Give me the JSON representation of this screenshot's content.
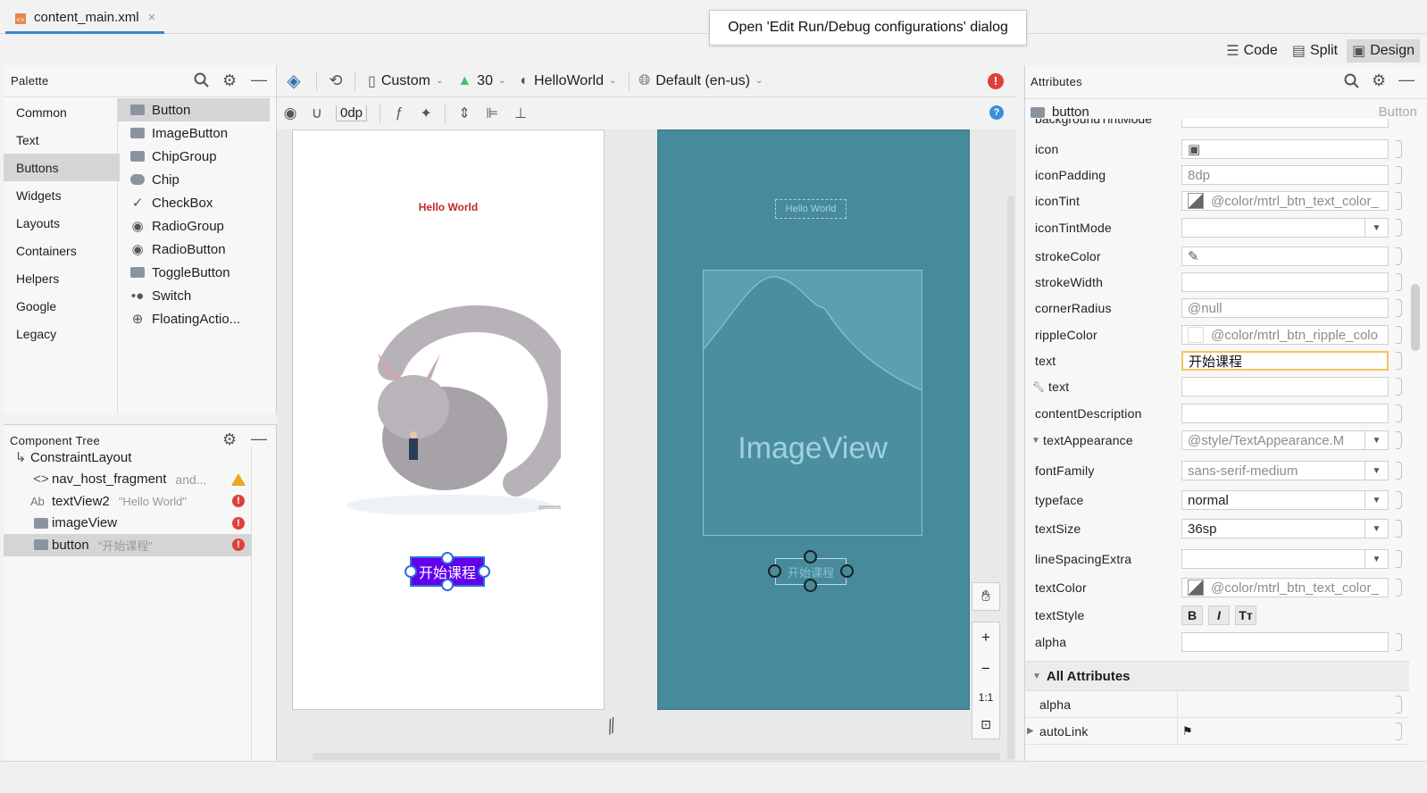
{
  "file_tab": {
    "name": "content_main.xml",
    "close": "×"
  },
  "tooltip": "Open 'Edit Run/Debug configurations' dialog",
  "view_modes": {
    "code": "Code",
    "split": "Split",
    "design": "Design"
  },
  "palette": {
    "title": "Palette",
    "categories": [
      "Common",
      "Text",
      "Buttons",
      "Widgets",
      "Layouts",
      "Containers",
      "Helpers",
      "Google",
      "Legacy"
    ],
    "selected_category": "Buttons",
    "items": [
      "Button",
      "ImageButton",
      "ChipGroup",
      "Chip",
      "CheckBox",
      "RadioGroup",
      "RadioButton",
      "ToggleButton",
      "Switch",
      "FloatingActio..."
    ]
  },
  "component_tree": {
    "title": "Component Tree",
    "rows": [
      {
        "label": "ConstraintLayout",
        "hint": "",
        "status": ""
      },
      {
        "label": "nav_host_fragment",
        "hint": "and...",
        "status": "warning"
      },
      {
        "label": "textView2",
        "hint": "\"Hello World\"",
        "status": "error"
      },
      {
        "label": "imageView",
        "hint": "",
        "status": "error"
      },
      {
        "label": "button",
        "hint": "\"开始课程\"",
        "status": "error"
      }
    ],
    "ab_prefix": "Ab"
  },
  "design_toolbar": {
    "device": "Custom",
    "api": "30",
    "theme": "HelloWorld",
    "locale": "Default (en-us)",
    "margin": "0dp"
  },
  "preview": {
    "hello": "Hello World",
    "button_text": "开始课程",
    "image_label": "ImageView",
    "signature": "@BBBBBB"
  },
  "zoom": {
    "plus": "+",
    "minus": "−",
    "one": "1:1"
  },
  "attributes": {
    "title": "Attributes",
    "component": "button",
    "component_type": "Button",
    "cut_label": "backgroundTintMode",
    "rows": [
      {
        "label": "icon",
        "value": "",
        "kind": "image"
      },
      {
        "label": "iconPadding",
        "value": "8dp",
        "kind": "text"
      },
      {
        "label": "iconTint",
        "value": "@color/mtrl_btn_text_color_",
        "kind": "color"
      },
      {
        "label": "iconTintMode",
        "value": "",
        "kind": "dropdown"
      },
      {
        "label": "strokeColor",
        "value": "",
        "kind": "picker"
      },
      {
        "label": "strokeWidth",
        "value": "",
        "kind": "text"
      },
      {
        "label": "cornerRadius",
        "value": "@null",
        "kind": "text"
      },
      {
        "label": "rippleColor",
        "value": "@color/mtrl_btn_ripple_colo",
        "kind": "color-empty"
      },
      {
        "label": "text",
        "value": "开始课程",
        "kind": "focus"
      },
      {
        "label": "text",
        "value": "",
        "kind": "text",
        "wrench": true
      },
      {
        "label": "contentDescription",
        "value": "",
        "kind": "text"
      },
      {
        "label": "textAppearance",
        "value": "@style/TextAppearance.M",
        "kind": "dropdown",
        "expander": true
      },
      {
        "label": "fontFamily",
        "value": "sans-serif-medium",
        "kind": "dropdown"
      },
      {
        "label": "typeface",
        "value": "normal",
        "kind": "dropdown-dark"
      },
      {
        "label": "textSize",
        "value": "36sp",
        "kind": "dropdown-dark"
      },
      {
        "label": "lineSpacingExtra",
        "value": "",
        "kind": "dropdown"
      },
      {
        "label": "textColor",
        "value": "@color/mtrl_btn_text_color_",
        "kind": "color"
      },
      {
        "label": "textStyle",
        "value": "",
        "kind": "style"
      },
      {
        "label": "alpha",
        "value": "",
        "kind": "text"
      }
    ],
    "text_style": {
      "bold": "B",
      "italic": "I",
      "caps": "Tт"
    },
    "all_attributes": "All Attributes",
    "all_rows": [
      "alpha",
      "autoLink"
    ]
  },
  "colors": {
    "accent": "#4083c9",
    "error": "#e0403c",
    "warning": "#eaa725",
    "blueprint": "#468a9c",
    "button": "#6200ee"
  }
}
